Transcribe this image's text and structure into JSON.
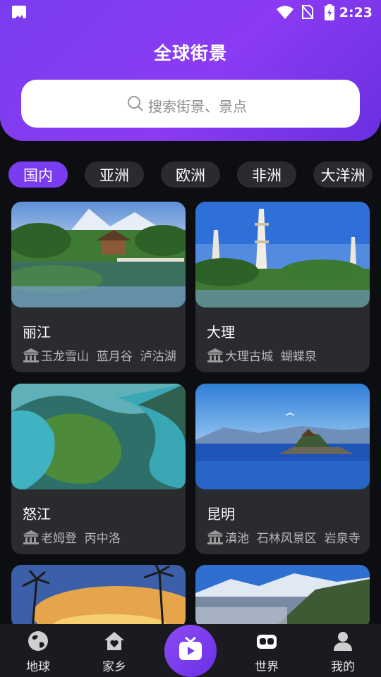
{
  "status_bar": {
    "time": "2:23"
  },
  "header": {
    "title": "全球街景"
  },
  "search": {
    "placeholder": "搜索街景、景点"
  },
  "chips": [
    {
      "label": "国内",
      "active": true
    },
    {
      "label": "亚洲",
      "active": false
    },
    {
      "label": "欧洲",
      "active": false
    },
    {
      "label": "非洲",
      "active": false
    },
    {
      "label": "大洋洲",
      "active": false
    }
  ],
  "cards": [
    {
      "name": "丽江",
      "spots": "玉龙雪山  蓝月谷  泸沽湖"
    },
    {
      "name": "大理",
      "spots": "大理古城  蝴蝶泉"
    },
    {
      "name": "怒江",
      "spots": "老姆登  丙中洛"
    },
    {
      "name": "昆明",
      "spots": "滇池  石林风景区  岩泉寺"
    },
    {
      "name": "",
      "spots": ""
    },
    {
      "name": "",
      "spots": ""
    }
  ],
  "tabbar": [
    {
      "label": "地球",
      "icon": "globe-icon",
      "active": false
    },
    {
      "label": "家乡",
      "icon": "home-heart-icon",
      "active": false
    },
    {
      "label": "",
      "icon": "tv-play-icon",
      "active": false
    },
    {
      "label": "世界",
      "icon": "vr-headset-icon",
      "active": true
    },
    {
      "label": "我的",
      "icon": "person-icon",
      "active": false
    }
  ],
  "colors": {
    "accent": "#7a3cf0",
    "background": "#0d0e12",
    "card": "#2a2b2f"
  }
}
